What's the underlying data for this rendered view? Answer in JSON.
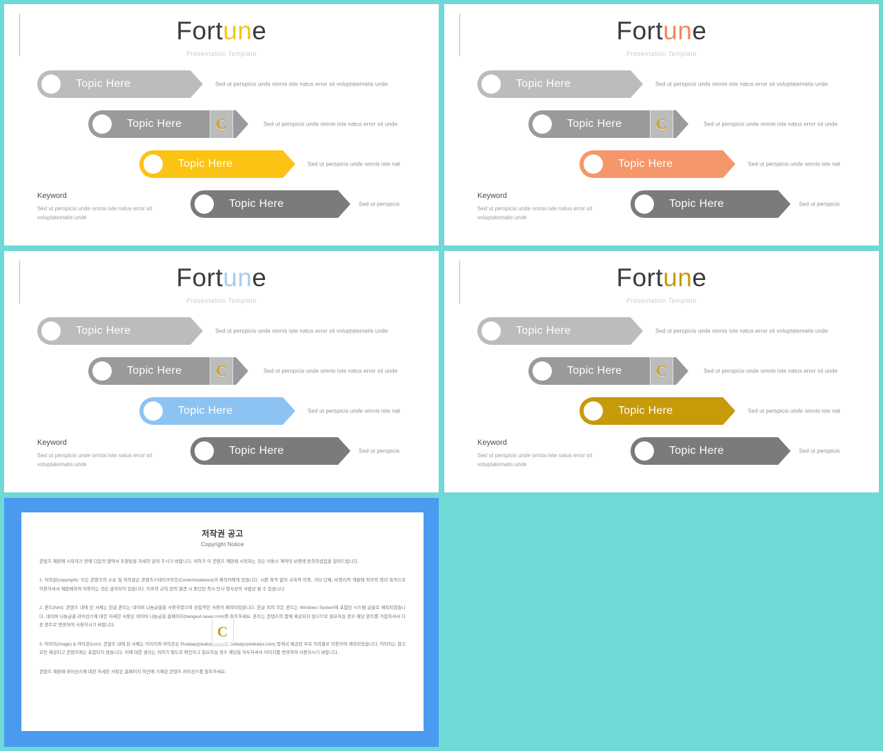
{
  "theme": {
    "page_background": "#6ed9d6",
    "card_background": "#ffffff",
    "copyright_frame": "#4a9af0",
    "muted_text": "#8e8e8e",
    "title_text": "#3b3b3b"
  },
  "brand": {
    "part_1": "Fort",
    "part_accent": "un",
    "part_2": "e",
    "subtitle": "Presentation  Template"
  },
  "shared": {
    "keyword_title": "Keyword",
    "keyword_body": "Sed ut perspicis unde  omnis iste natus error sit voluptatematis  unde",
    "watermark_letter": "C",
    "rows": [
      {
        "label": "Topic Here",
        "desc": "Sed ut perspicis  unde  omnis iste natus error sit voluptatematis  unde"
      },
      {
        "label": "Topic Here",
        "desc": "Sed ut perspicis  unde  omnis iste natus error sit unde"
      },
      {
        "label": "Topic Here",
        "desc": "Sed ut perspicis  unde  omnis iste nat"
      },
      {
        "label": "Topic Here",
        "desc": "Sed ut perspicis"
      }
    ]
  },
  "slides": [
    {
      "id": "slide-1",
      "accent_color": "#f5c518",
      "highlight_row_color": "#fbc313",
      "row_colors": [
        "#bcbcbc",
        "#9a9a9a",
        "#fbc313",
        "#7b7b7b"
      ]
    },
    {
      "id": "slide-2",
      "accent_color": "#f08b5b",
      "highlight_row_color": "#f4976a",
      "row_colors": [
        "#bcbcbc",
        "#9a9a9a",
        "#f4976a",
        "#7b7b7b"
      ]
    },
    {
      "id": "slide-3",
      "accent_color": "#a8cdf0",
      "highlight_row_color": "#8cc3f2",
      "row_colors": [
        "#bcbcbc",
        "#9a9a9a",
        "#8cc3f2",
        "#7b7b7b"
      ]
    },
    {
      "id": "slide-4",
      "accent_color": "#c79a0a",
      "highlight_row_color": "#c79a0a",
      "row_colors": [
        "#bcbcbc",
        "#9a9a9a",
        "#c79a0a",
        "#7b7b7b"
      ]
    }
  ],
  "copyright": {
    "title_ko": "저작권 공고",
    "title_en": "Copyright Notice",
    "intro": "콘텐츠 재판매 시작하기 전에 다음의 협약서 조항들을 자세히 읽어 주시기 바랍니다. 귀하가 이 콘텐츠 재판매 시작하는 것은 사용시 계약의 보증에 동의하셨음을 알려드립니다.",
    "para_1": "1. 저작권(copyright): 모든 콘텐츠의 소유 및 저작권은 콘텐츠스테이크아웃(Contentstakeout)과 제작자에게 있습니다. 시판 목적 없이 교육적 이용, 기타 단체, 비영리적 개발에 외부의 영리 목적으로 이용하셔서 재판매하여 이용하는 것은 금지되어 있습니다. 이후의 교칙 정의 발견 시 중단된 즉시 민사 형사상의 사법상 될 수 있습니다.",
    "para_2": "2. 폰트(font): 콘텐츠 내에 된 서체는 한글 폰트는 네이버 나눔글꼴을 사용하였으며 상업적인 사용이 제작되었습니다. 한글 외의 모든 폰트는 Windows System에 포함된 시스템 글꼴로 제작되었습니다. 네이버 나눔글꼴 라이선스에 대한 자세한 사항은 네이버 나눔글꼴 홈페이지(hangeul.naver.com)를 참조하세요. 폰트는 콘텐츠의 함께 제공되지 않으므로 필요하실 경우 해당 폰트를 가입하셔서 다른 폰트로 변경하여 사용하시기 바랍니다.",
    "para_3": "3. 이미지(image) & 아이콘(icon): 콘텐츠 내에 된 서체는 이미지와 아이콘은 Pixabay(pixabay.com)와 Webalys(webalys.com) 등에서 제공된 무료 저작물로 이용하여 제작되었습니다. 이미지는 참고로만 제공되고 콘텐츠에는 포함되지 않습니다. 이에 대한 권리는 귀하가 별도로 확인하고 필요하실 경우 해당을 하두하셔서 이미지를 변경하여 사용하시기 바랍니다.",
    "outro": "콘텐츠 재판매 라이선스에 대한 자세한 사항은 홈페이지 하단에 기재된 콘텐츠 라이선스를 참조하세요."
  }
}
